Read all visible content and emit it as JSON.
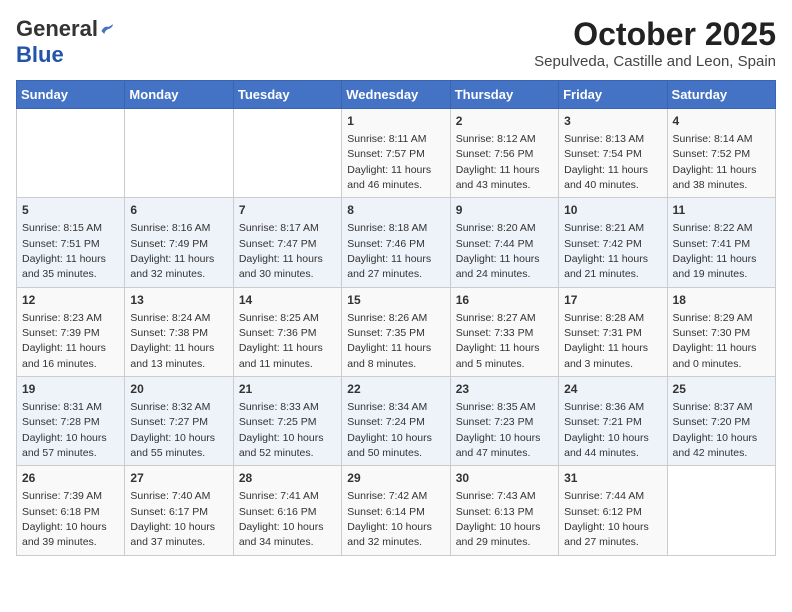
{
  "header": {
    "logo_general": "General",
    "logo_blue": "Blue",
    "title": "October 2025",
    "subtitle": "Sepulveda, Castille and Leon, Spain"
  },
  "days_of_week": [
    "Sunday",
    "Monday",
    "Tuesday",
    "Wednesday",
    "Thursday",
    "Friday",
    "Saturday"
  ],
  "weeks": [
    [
      {
        "day": "",
        "info": ""
      },
      {
        "day": "",
        "info": ""
      },
      {
        "day": "",
        "info": ""
      },
      {
        "day": "1",
        "sunrise": "8:11 AM",
        "sunset": "7:57 PM",
        "daylight": "11 hours and 46 minutes."
      },
      {
        "day": "2",
        "sunrise": "8:12 AM",
        "sunset": "7:56 PM",
        "daylight": "11 hours and 43 minutes."
      },
      {
        "day": "3",
        "sunrise": "8:13 AM",
        "sunset": "7:54 PM",
        "daylight": "11 hours and 40 minutes."
      },
      {
        "day": "4",
        "sunrise": "8:14 AM",
        "sunset": "7:52 PM",
        "daylight": "11 hours and 38 minutes."
      }
    ],
    [
      {
        "day": "5",
        "sunrise": "8:15 AM",
        "sunset": "7:51 PM",
        "daylight": "11 hours and 35 minutes."
      },
      {
        "day": "6",
        "sunrise": "8:16 AM",
        "sunset": "7:49 PM",
        "daylight": "11 hours and 32 minutes."
      },
      {
        "day": "7",
        "sunrise": "8:17 AM",
        "sunset": "7:47 PM",
        "daylight": "11 hours and 30 minutes."
      },
      {
        "day": "8",
        "sunrise": "8:18 AM",
        "sunset": "7:46 PM",
        "daylight": "11 hours and 27 minutes."
      },
      {
        "day": "9",
        "sunrise": "8:20 AM",
        "sunset": "7:44 PM",
        "daylight": "11 hours and 24 minutes."
      },
      {
        "day": "10",
        "sunrise": "8:21 AM",
        "sunset": "7:42 PM",
        "daylight": "11 hours and 21 minutes."
      },
      {
        "day": "11",
        "sunrise": "8:22 AM",
        "sunset": "7:41 PM",
        "daylight": "11 hours and 19 minutes."
      }
    ],
    [
      {
        "day": "12",
        "sunrise": "8:23 AM",
        "sunset": "7:39 PM",
        "daylight": "11 hours and 16 minutes."
      },
      {
        "day": "13",
        "sunrise": "8:24 AM",
        "sunset": "7:38 PM",
        "daylight": "11 hours and 13 minutes."
      },
      {
        "day": "14",
        "sunrise": "8:25 AM",
        "sunset": "7:36 PM",
        "daylight": "11 hours and 11 minutes."
      },
      {
        "day": "15",
        "sunrise": "8:26 AM",
        "sunset": "7:35 PM",
        "daylight": "11 hours and 8 minutes."
      },
      {
        "day": "16",
        "sunrise": "8:27 AM",
        "sunset": "7:33 PM",
        "daylight": "11 hours and 5 minutes."
      },
      {
        "day": "17",
        "sunrise": "8:28 AM",
        "sunset": "7:31 PM",
        "daylight": "11 hours and 3 minutes."
      },
      {
        "day": "18",
        "sunrise": "8:29 AM",
        "sunset": "7:30 PM",
        "daylight": "11 hours and 0 minutes."
      }
    ],
    [
      {
        "day": "19",
        "sunrise": "8:31 AM",
        "sunset": "7:28 PM",
        "daylight": "10 hours and 57 minutes."
      },
      {
        "day": "20",
        "sunrise": "8:32 AM",
        "sunset": "7:27 PM",
        "daylight": "10 hours and 55 minutes."
      },
      {
        "day": "21",
        "sunrise": "8:33 AM",
        "sunset": "7:25 PM",
        "daylight": "10 hours and 52 minutes."
      },
      {
        "day": "22",
        "sunrise": "8:34 AM",
        "sunset": "7:24 PM",
        "daylight": "10 hours and 50 minutes."
      },
      {
        "day": "23",
        "sunrise": "8:35 AM",
        "sunset": "7:23 PM",
        "daylight": "10 hours and 47 minutes."
      },
      {
        "day": "24",
        "sunrise": "8:36 AM",
        "sunset": "7:21 PM",
        "daylight": "10 hours and 44 minutes."
      },
      {
        "day": "25",
        "sunrise": "8:37 AM",
        "sunset": "7:20 PM",
        "daylight": "10 hours and 42 minutes."
      }
    ],
    [
      {
        "day": "26",
        "sunrise": "7:39 AM",
        "sunset": "6:18 PM",
        "daylight": "10 hours and 39 minutes."
      },
      {
        "day": "27",
        "sunrise": "7:40 AM",
        "sunset": "6:17 PM",
        "daylight": "10 hours and 37 minutes."
      },
      {
        "day": "28",
        "sunrise": "7:41 AM",
        "sunset": "6:16 PM",
        "daylight": "10 hours and 34 minutes."
      },
      {
        "day": "29",
        "sunrise": "7:42 AM",
        "sunset": "6:14 PM",
        "daylight": "10 hours and 32 minutes."
      },
      {
        "day": "30",
        "sunrise": "7:43 AM",
        "sunset": "6:13 PM",
        "daylight": "10 hours and 29 minutes."
      },
      {
        "day": "31",
        "sunrise": "7:44 AM",
        "sunset": "6:12 PM",
        "daylight": "10 hours and 27 minutes."
      },
      {
        "day": "",
        "info": ""
      }
    ]
  ]
}
